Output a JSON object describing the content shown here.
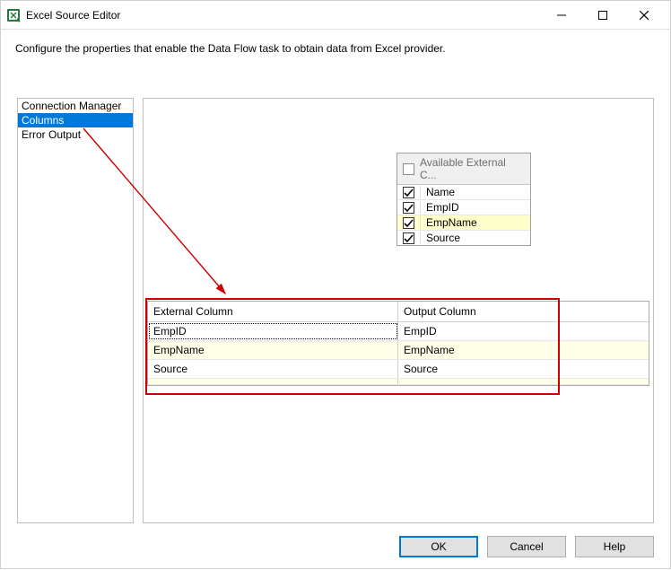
{
  "window": {
    "title": "Excel Source Editor"
  },
  "subtitle": "Configure the properties that enable the Data Flow task to obtain data from Excel provider.",
  "sidebar": {
    "items": [
      {
        "label": "Connection Manager"
      },
      {
        "label": "Columns"
      },
      {
        "label": "Error Output"
      }
    ]
  },
  "available": {
    "header": "Available External C...",
    "rows": [
      {
        "label": "Name",
        "checked": true
      },
      {
        "label": "EmpID",
        "checked": true
      },
      {
        "label": "EmpName",
        "checked": true
      },
      {
        "label": "Source",
        "checked": true
      }
    ]
  },
  "grid": {
    "headers": {
      "c1": "External Column",
      "c2": "Output Column"
    },
    "rows": [
      {
        "ext": "EmpID",
        "out": "EmpID"
      },
      {
        "ext": "EmpName",
        "out": "EmpName"
      },
      {
        "ext": "Source",
        "out": "Source"
      }
    ]
  },
  "buttons": {
    "ok": "OK",
    "cancel": "Cancel",
    "help": "Help"
  }
}
